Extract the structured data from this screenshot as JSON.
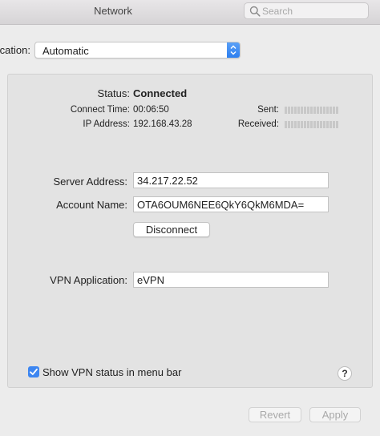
{
  "window": {
    "title": "Network"
  },
  "search": {
    "placeholder": "Search"
  },
  "configuration": {
    "label": "ication:",
    "value": "Automatic"
  },
  "status": {
    "label": "Status:",
    "value": "Connected",
    "connect_time_label": "Connect Time:",
    "connect_time": "00:06:50",
    "ip_label": "IP Address:",
    "ip": "192.168.43.28",
    "sent_label": "Sent:",
    "received_label": "Received:"
  },
  "server": {
    "label": "Server Address:",
    "value": "34.217.22.52"
  },
  "account": {
    "label": "Account Name:",
    "value": "OTA6OUM6NEE6QkY6QkM6MDA="
  },
  "disconnect_label": "Disconnect",
  "vpn_app": {
    "label": "VPN Application:",
    "value": "eVPN"
  },
  "show_status": {
    "label": "Show VPN status in menu bar",
    "checked": true
  },
  "help_label": "?",
  "footer": {
    "revert_label": "Revert",
    "apply_label": "Apply"
  },
  "colors": {
    "accent": "#3d86f1",
    "panel": "#e3e3e3",
    "window": "#ececec"
  }
}
